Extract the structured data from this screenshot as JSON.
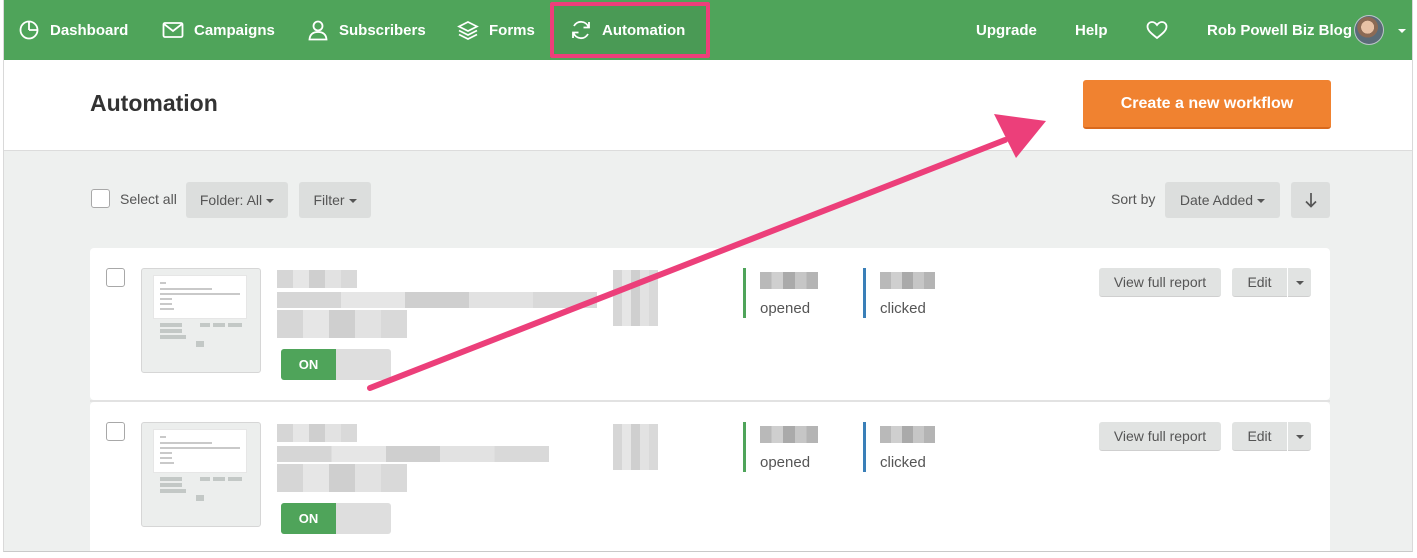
{
  "nav": {
    "left": [
      {
        "label": "Dashboard",
        "icon": "dashboard-icon"
      },
      {
        "label": "Campaigns",
        "icon": "envelope-icon"
      },
      {
        "label": "Subscribers",
        "icon": "user-icon"
      },
      {
        "label": "Forms",
        "icon": "layers-icon"
      },
      {
        "label": "Automation",
        "icon": "refresh-icon"
      }
    ],
    "right": {
      "upgrade": "Upgrade",
      "help": "Help",
      "account": "Rob Powell Biz Blog"
    }
  },
  "header": {
    "title": "Automation",
    "create_button": "Create a new workflow"
  },
  "toolbar": {
    "select_all": "Select all",
    "folder": "Folder: All",
    "filter": "Filter",
    "sort_by": "Sort by",
    "sort_value": "Date Added"
  },
  "workflows": [
    {
      "toggle": "ON",
      "opened_label": "opened",
      "clicked_label": "clicked",
      "report_button": "View full report",
      "edit_button": "Edit"
    },
    {
      "toggle": "ON",
      "opened_label": "opened",
      "clicked_label": "clicked",
      "report_button": "View full report",
      "edit_button": "Edit"
    }
  ],
  "colors": {
    "nav_green": "#4fa45a",
    "accent_orange": "#f08230",
    "annotation_pink": "#ec3f7a",
    "opened_bar": "#4fa45a",
    "clicked_bar": "#3a7fb8"
  }
}
